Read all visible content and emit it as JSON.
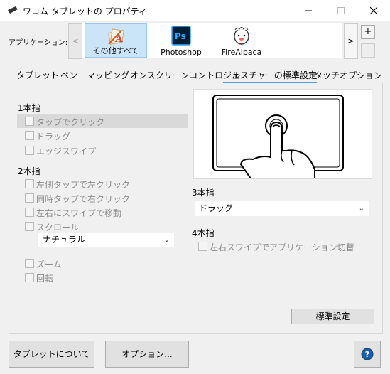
{
  "window": {
    "title": "ワコム タブレットの プロパティ"
  },
  "applications": {
    "label": "アプリケーション:",
    "items": [
      {
        "name": "その他すべて",
        "selected": true,
        "icon": "all-other-apps-icon"
      },
      {
        "name": "Photoshop",
        "selected": false,
        "icon": "photoshop-icon"
      },
      {
        "name": "FireAlpaca",
        "selected": false,
        "icon": "firealpaca-icon"
      }
    ],
    "add_label": "+",
    "remove_label": "-"
  },
  "tabs": [
    {
      "label": "タブレット",
      "active": false
    },
    {
      "label": "ペン",
      "active": false
    },
    {
      "label": "マッピング",
      "active": false
    },
    {
      "label": "オンスクリーンコントロール",
      "active": false
    },
    {
      "label": "ジェスチャーの標準設定",
      "active": true
    },
    {
      "label": "タッチオプション",
      "active": false
    }
  ],
  "gestures": {
    "one_finger": {
      "title": "1本指",
      "options": [
        "タップでクリック",
        "ドラッグ",
        "エッジスワイプ"
      ]
    },
    "two_finger": {
      "title": "2本指",
      "options": [
        "左側タップで左クリック",
        "同時タップで右クリック",
        "左右にスワイプで移動",
        "スクロール"
      ],
      "scroll_mode": "ナチュラル",
      "extra_options": [
        "ズーム",
        "回転"
      ]
    },
    "three_finger": {
      "title": "3本指",
      "value": "ドラッグ"
    },
    "four_finger": {
      "title": "4本指",
      "options": [
        "左右スワイプでアプリケーション切替"
      ]
    }
  },
  "buttons": {
    "default": "標準設定",
    "about": "タブレットについて",
    "options": "オプション...",
    "help": "?"
  },
  "colors": {
    "accent": "#4aa3df",
    "selected_app": "#cce4f7",
    "disabled_text": "#8a8a8a",
    "help_blue": "#1a5ea8"
  }
}
